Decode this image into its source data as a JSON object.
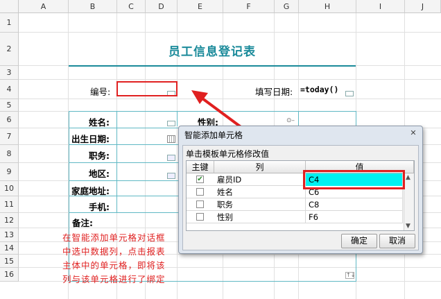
{
  "columns": [
    "A",
    "B",
    "C",
    "D",
    "E",
    "F",
    "G",
    "H",
    "I",
    "J"
  ],
  "rows": [
    "1",
    "2",
    "3",
    "4",
    "5",
    "6",
    "7",
    "8",
    "9",
    "10",
    "11",
    "12",
    "13",
    "14",
    "15",
    "16"
  ],
  "sheet": {
    "title": "员工信息登记表",
    "serial_label": "编号:",
    "fill_date_label": "填写日期:",
    "fill_date_formula": "=today()",
    "name_label": "姓名:",
    "gender_label": "性别:",
    "birth_label": "出生日期:",
    "position_label": "职务:",
    "region_label": "地区:",
    "address_label": "家庭地址:",
    "mobile_label": "手机:",
    "remark_label": "备注:"
  },
  "annotation": {
    "lines": [
      "在智能添加单元格对话框",
      "中选中数据列，点击报表",
      "主体中的单元格，即将该",
      "列与该单元格进行了绑定"
    ],
    "color": "#e02020"
  },
  "dialog": {
    "title": "智能添加单元格",
    "close": "✕",
    "hint": "单击模板单元格修改值",
    "headers": {
      "key": "主键",
      "column": "列",
      "value": "值"
    },
    "rows": [
      {
        "checked": true,
        "column": "雇员ID",
        "value": "C4"
      },
      {
        "checked": false,
        "column": "姓名",
        "value": "C6"
      },
      {
        "checked": false,
        "column": "职务",
        "value": "C8"
      },
      {
        "checked": false,
        "column": "性别",
        "value": "F6"
      }
    ],
    "ok_label": "确定",
    "cancel_label": "取消",
    "selected_color": "#00f0f0"
  },
  "colors": {
    "accent": "#1a8a9a",
    "highlight": "#e02020",
    "table_border": "#5fb8c4"
  }
}
